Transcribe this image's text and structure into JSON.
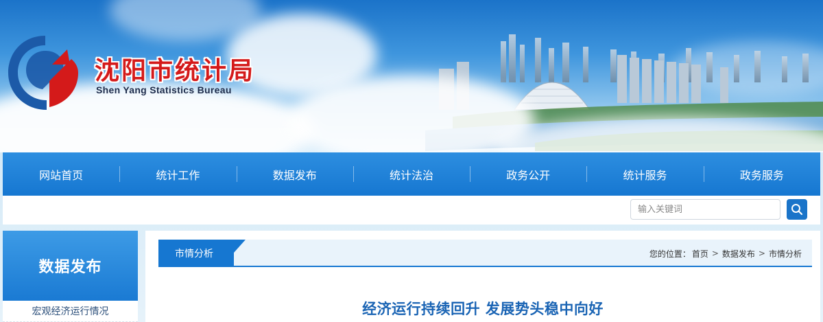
{
  "header": {
    "title_cn": "沈阳市统计局",
    "title_en": "Shen Yang Statistics Bureau",
    "brand_color": "#d41a1a"
  },
  "nav": {
    "items": [
      {
        "label": "网站首页"
      },
      {
        "label": "统计工作"
      },
      {
        "label": "数据发布"
      },
      {
        "label": "统计法治"
      },
      {
        "label": "政务公开"
      },
      {
        "label": "统计服务"
      },
      {
        "label": "政务服务"
      }
    ],
    "accent": "#1677d1"
  },
  "search": {
    "placeholder": "输入关键词",
    "icon": "search-icon"
  },
  "sidebar": {
    "heading": "数据发布",
    "items": [
      {
        "label": "宏观经济运行情况"
      }
    ]
  },
  "main": {
    "section_tab": "市情分析",
    "breadcrumb": {
      "prefix": "您的位置：",
      "items": [
        "首页",
        "数据发布",
        "市情分析"
      ],
      "separator": ">"
    },
    "article_title": "经济运行持续回升 发展势头稳中向好"
  }
}
